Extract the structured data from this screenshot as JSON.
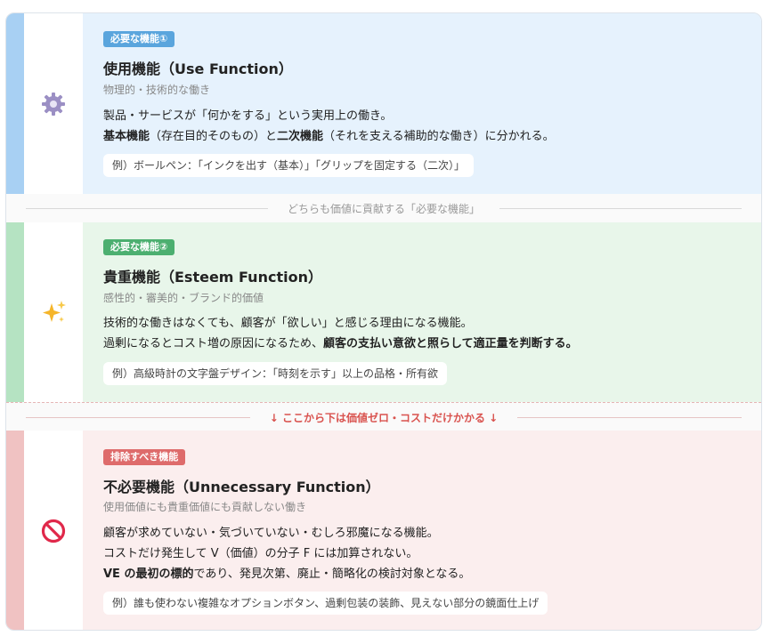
{
  "colors": {
    "blue_bar": "#a8d0f3",
    "blue_bg": "#e6f2fd",
    "blue_badge": "#5aa5dd",
    "green_bar": "#b5e3c2",
    "green_bg": "#e8f6ea",
    "green_badge": "#4caf70",
    "red_bar": "#f0c2c2",
    "red_bg": "#fbeeee",
    "red_badge": "#de6b6b"
  },
  "sections": [
    {
      "icon": "gear-icon",
      "badge": "必要な機能①",
      "title": "使用機能（Use Function）",
      "subtitle": "物理的・技術的な働き",
      "desc1": "製品・サービスが「何かをする」という実用上の働き。",
      "desc2_b1": "基本機能",
      "desc2_t1": "（存在目的そのもの）と",
      "desc2_b2": "二次機能",
      "desc2_t2": "（それを支える補助的な働き）に分かれる。",
      "example": "例）ボールペン：「インクを出す（基本）」「グリップを固定する（二次）」"
    },
    {
      "icon": "sparkles-icon",
      "badge": "必要な機能②",
      "title": "貴重機能（Esteem Function）",
      "subtitle": "感性的・審美的・ブランド的価値",
      "desc1": "技術的な働きはなくても、顧客が「欲しい」と感じる理由になる機能。",
      "desc2_t1": "過剰になるとコスト増の原因になるため、",
      "desc2_b1": "顧客の支払い意欲と照らして適正量を判断する。",
      "example": "例）高級時計の文字盤デザイン：「時刻を示す」以上の品格・所有欲"
    },
    {
      "icon": "prohibited-icon",
      "badge": "排除すべき機能",
      "title": "不必要機能（Unnecessary Function）",
      "subtitle": "使用価値にも貴重価値にも貢献しない働き",
      "desc1": "顧客が求めていない・気づいていない・むしろ邪魔になる機能。",
      "desc2": "コストだけ発生して V（価値）の分子 F には加算されない。",
      "desc3_b1": "VE の最初の標的",
      "desc3_t1": "であり、発見次第、廃止・簡略化の検討対象となる。",
      "example": "例）誰も使わない複雑なオプションボタン、過剰包装の装飾、見えない部分の鏡面仕上げ"
    }
  ],
  "dividers": {
    "necessary": "どちらも価値に貢献する「必要な機能」",
    "warning": "↓ ここから下は価値ゼロ・コストだけかかる ↓"
  }
}
